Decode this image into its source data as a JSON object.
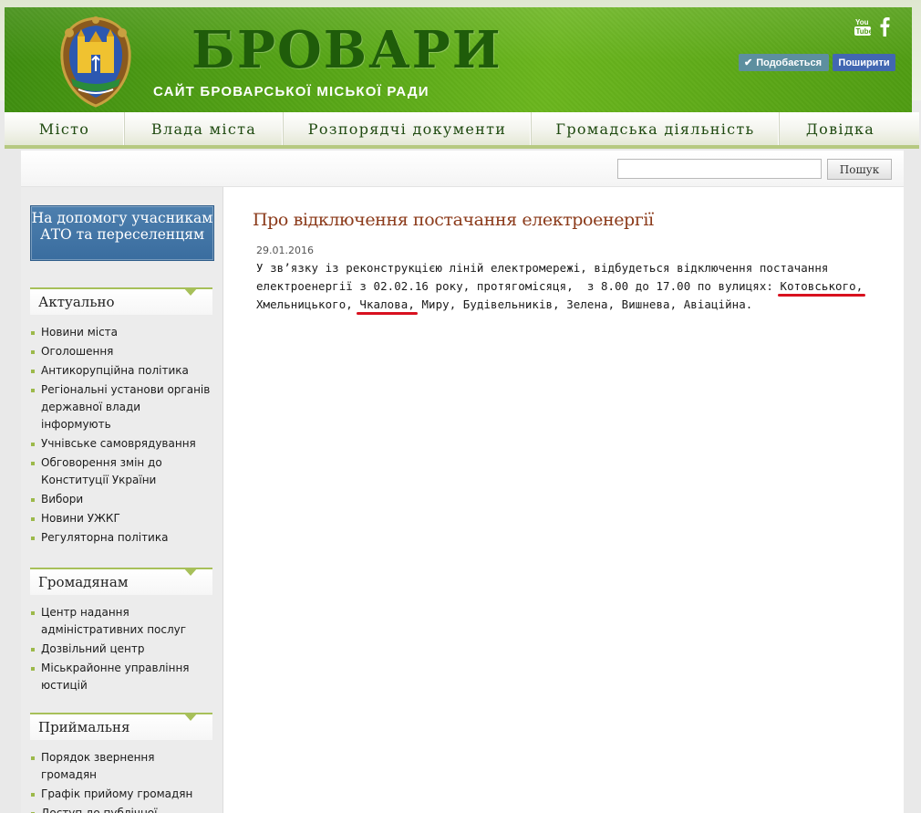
{
  "header": {
    "title": "БРОВАРИ",
    "subtitle": "САЙТ БРОВАРСЬКОЇ МІСЬКОЇ РАДИ",
    "social": {
      "youtube_icon": "youtube-icon",
      "facebook_icon": "facebook-icon"
    },
    "like_label": "Подобається",
    "share_label": "Поширити",
    "colors": {
      "header_green": "#56a516",
      "title_green": "#1f5c0a",
      "like_bg": "#5d8f9f",
      "share_bg": "#4267b2"
    }
  },
  "nav": {
    "items": [
      {
        "label": "Місто"
      },
      {
        "label": "Влада міста"
      },
      {
        "label": "Розпорядчі документи"
      },
      {
        "label": "Громадська діяльність"
      },
      {
        "label": "Довідка"
      }
    ]
  },
  "search": {
    "placeholder": "",
    "button_label": "Пошук"
  },
  "sidebar": {
    "ato_banner": "На допомогу учасникам АТО та переселенцям",
    "blocks": [
      {
        "title": "Актуально",
        "items": [
          "Новини міста",
          "Оголошення",
          "Антикорупційна політика",
          "Регіональні установи органів державної влади інформують",
          "Учнівське самоврядування",
          "Обговорення змін до Конституції України",
          "Вибори",
          "Новини УЖКГ",
          "Регуляторна політика"
        ]
      },
      {
        "title": "Громадянам",
        "items": [
          "Центр надання адміністративних послуг",
          "Дозвільний центр",
          "Міськрайонне управління юстицій"
        ]
      },
      {
        "title": "Приймальня",
        "items": [
          "Порядок звернення громадян",
          "Графік прийому громадян",
          "Доступ до публічної"
        ]
      }
    ]
  },
  "article": {
    "title": "Про відключення постачання електроенергії",
    "date": "29.01.2016",
    "body": {
      "line1": "У зв’язку із реконструкцією ліній електромережі, відбудеться відключення постачання",
      "line2_pre": "електроенергії з 02.02.16 року, протягомісяця,  з 8.00 до 17.00 по вулицях: ",
      "street1": "Котовського,",
      "line3_pre": "Хмельницького, ",
      "street2": "Чкалова,",
      "line3_post": " Миру, Будівельників, Зелена, Вишнева, Авіаційна."
    }
  }
}
